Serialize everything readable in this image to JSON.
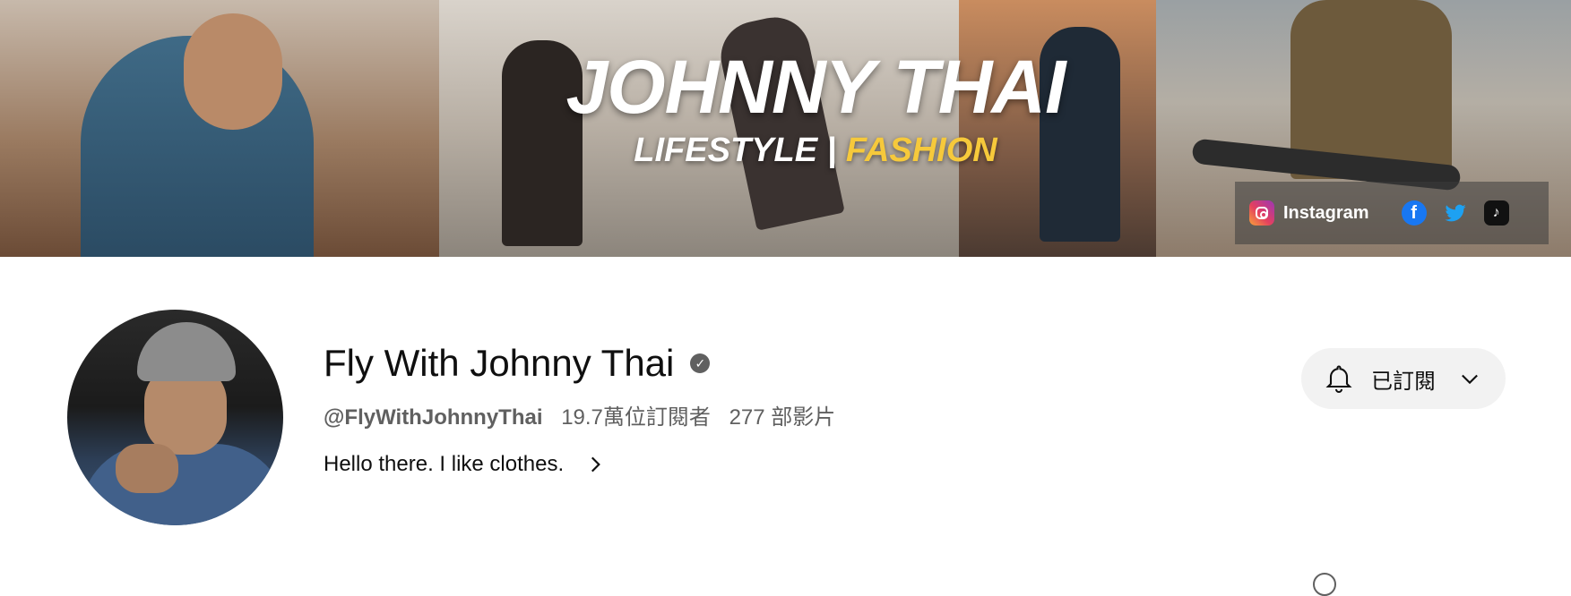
{
  "banner": {
    "title": "JOHNNY THAI",
    "tagline_part1": "LIFESTYLE",
    "tagline_separator": "|",
    "tagline_part2": "FASHION",
    "accent_color": "#f6c93b"
  },
  "links": [
    {
      "label": "Instagram",
      "icon": "instagram-icon"
    },
    {
      "label": "",
      "icon": "facebook-icon"
    },
    {
      "label": "",
      "icon": "twitter-icon"
    },
    {
      "label": "",
      "icon": "tiktok-icon"
    }
  ],
  "channel": {
    "name": "Fly With Johnny Thai",
    "verified_icon": "verified-check-icon",
    "handle": "@FlyWithJohnnyThai",
    "subscribers": "19.7萬位訂閱者",
    "videos": "277 部影片",
    "description": "Hello there. I like clothes."
  },
  "subscribe": {
    "label": "已訂閱",
    "icon": "bell-icon",
    "dropdown_icon": "chevron-down-icon"
  }
}
